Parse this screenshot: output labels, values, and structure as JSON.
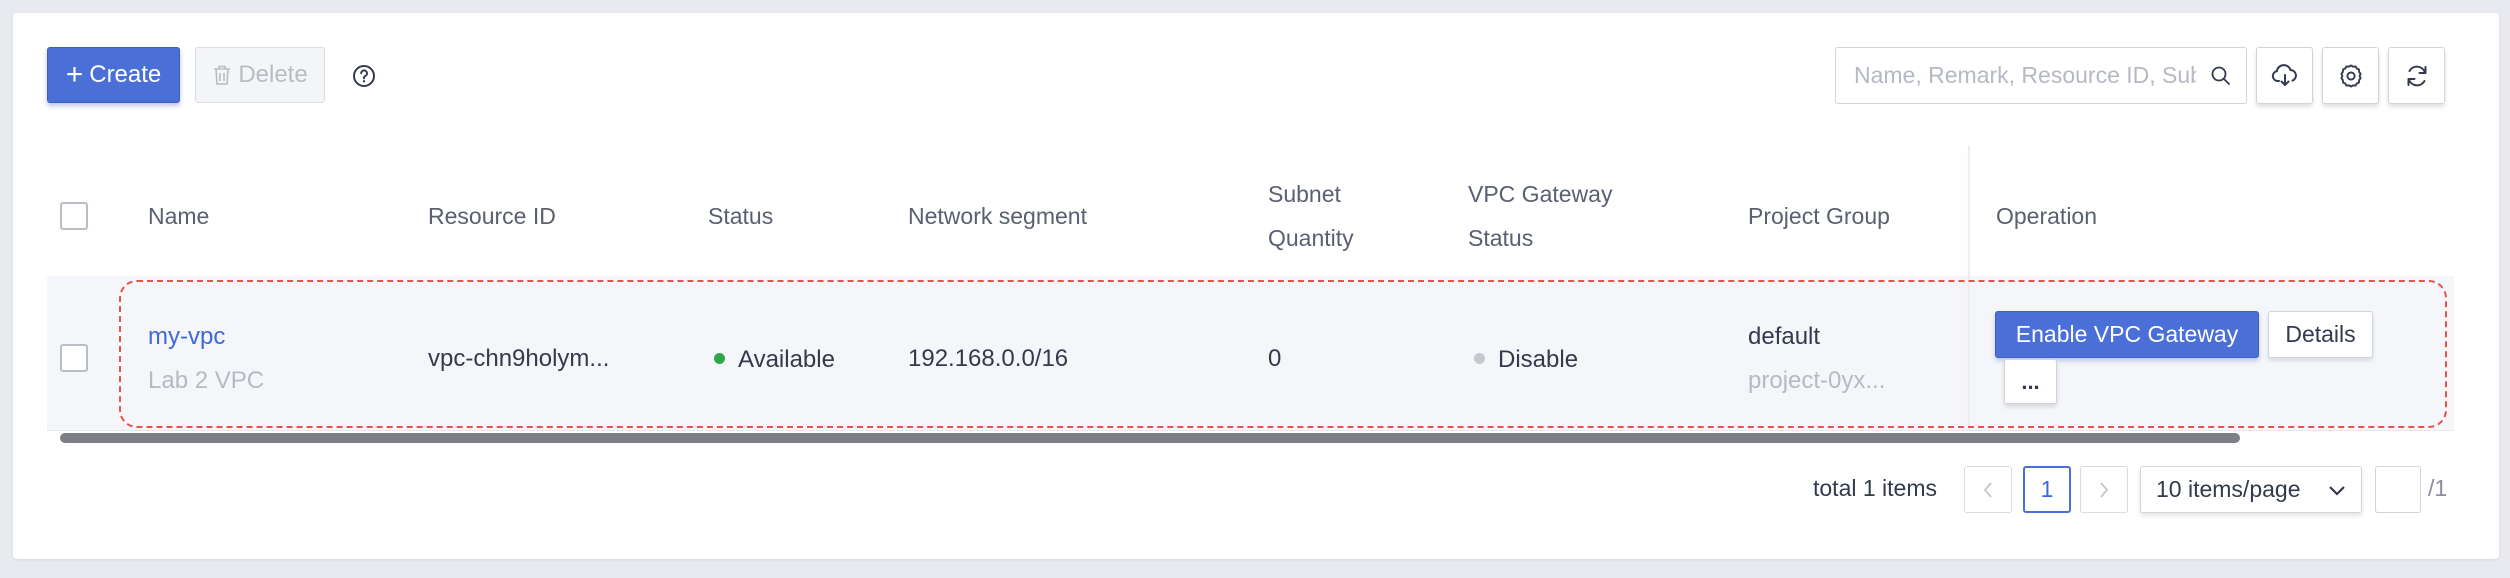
{
  "toolbar": {
    "create_label": "Create",
    "delete_label": "Delete",
    "search_placeholder": "Name, Remark, Resource ID, Subnet"
  },
  "table": {
    "columns": {
      "name": "Name",
      "resource_id": "Resource ID",
      "status": "Status",
      "network_segment": "Network segment",
      "subnet_quantity_line1": "Subnet",
      "subnet_quantity_line2": "Quantity",
      "vpc_gateway_status_line1": "VPC Gateway",
      "vpc_gateway_status_line2": "Status",
      "project_group": "Project Group",
      "operation": "Operation"
    },
    "rows": [
      {
        "name": "my-vpc",
        "remark": "Lab 2 VPC",
        "resource_id": "vpc-chn9holym...",
        "status": "Available",
        "status_color": "#2fa64a",
        "network_segment": "192.168.0.0/16",
        "subnet_quantity": "0",
        "vpc_gateway_status": "Disable",
        "vpc_gateway_status_color": "#c5c8cf",
        "project_group": "default",
        "project_id": "project-0yx...",
        "actions": {
          "enable_gateway": "Enable VPC Gateway",
          "details": "Details",
          "more": "..."
        }
      }
    ]
  },
  "pagination": {
    "total_text": "total 1 items",
    "current_page": "1",
    "page_size": "10 items/page",
    "total_pages": "/1",
    "page_input_value": ""
  },
  "colors": {
    "primary": "#4a6fd6",
    "link": "#3f69d6",
    "selection_outline": "#e5534b"
  }
}
